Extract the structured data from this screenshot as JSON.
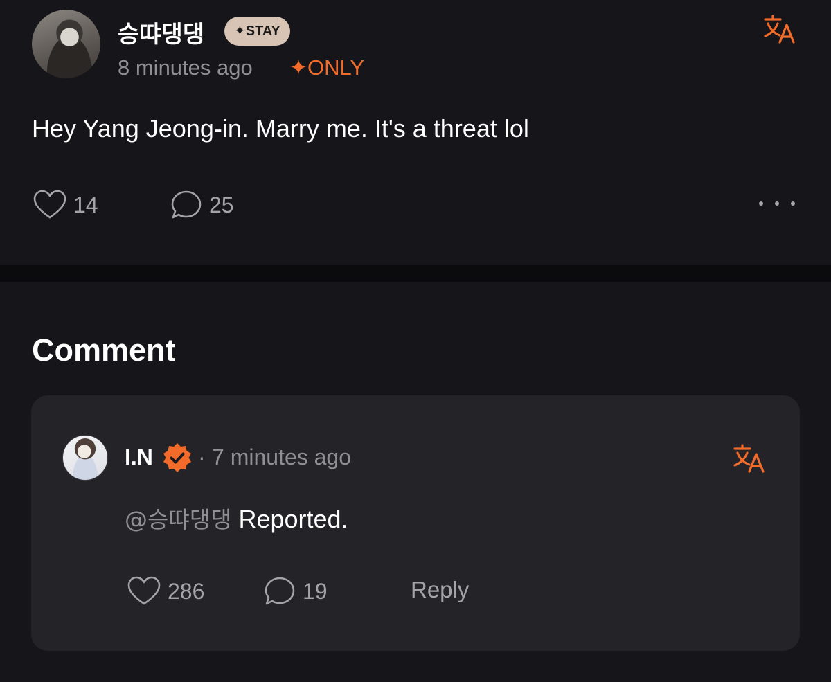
{
  "post": {
    "author": "승땨댕댕",
    "badge": "✦STAY",
    "time": "8 minutes ago",
    "access_badge": "✦ONLY",
    "body": "Hey Yang Jeong-in. Marry me. It's a threat lol",
    "likes": "14",
    "comments": "25"
  },
  "comments_section": {
    "title": "Comment",
    "items": [
      {
        "author": "I.N",
        "separator": "·",
        "time": "7 minutes ago",
        "mention": "@승땨댕댕",
        "text": " Reported.",
        "likes": "286",
        "replies": "19",
        "reply_label": "Reply"
      }
    ]
  },
  "colors": {
    "background": "#16161a",
    "card": "#232328",
    "accent": "#f26b2a",
    "muted_text": "#8f8f95",
    "badge_bg": "#d8c4b4"
  },
  "icons": {
    "translate": "translate-icon",
    "like": "heart-outline-icon",
    "comment": "speech-bubble-icon",
    "more": "more-dots-icon",
    "verified": "verified-badge-icon"
  }
}
